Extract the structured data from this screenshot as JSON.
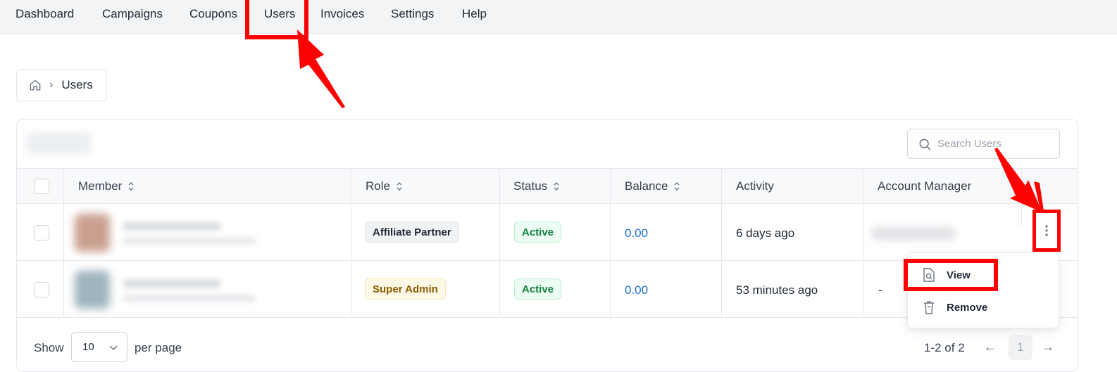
{
  "top_nav": {
    "items": [
      "Dashboard",
      "Campaigns",
      "Coupons",
      "Users",
      "Invoices",
      "Settings",
      "Help"
    ]
  },
  "breadcrumb": {
    "current": "Users"
  },
  "search": {
    "placeholder": "Search Users"
  },
  "table": {
    "headers": {
      "member": "Member",
      "role": "Role",
      "status": "Status",
      "balance": "Balance",
      "activity": "Activity",
      "account_manager": "Account Manager"
    },
    "rows": [
      {
        "role": "Affiliate Partner",
        "status": "Active",
        "balance": "0.00",
        "activity": "6 days ago",
        "account_manager": ""
      },
      {
        "role": "Super Admin",
        "status": "Active",
        "balance": "0.00",
        "activity": "53 minutes ago",
        "account_manager": "-"
      }
    ]
  },
  "row_menu": {
    "items": [
      "View",
      "Remove"
    ]
  },
  "pagination": {
    "show_label": "Show",
    "per_page_value": "10",
    "per_page_label": "per page",
    "range": "1-2 of 2",
    "current_page": "1"
  },
  "colors": {
    "highlight": "#ff0000",
    "balance_link": "#1d6fd6",
    "status_active": "#15803d"
  },
  "icons": [
    "home-icon",
    "chevron-right-icon",
    "search-icon",
    "sort-icon",
    "kebab-menu-icon",
    "view-document-icon",
    "trash-icon",
    "chevron-down-icon",
    "arrow-left-icon",
    "arrow-right-icon"
  ]
}
